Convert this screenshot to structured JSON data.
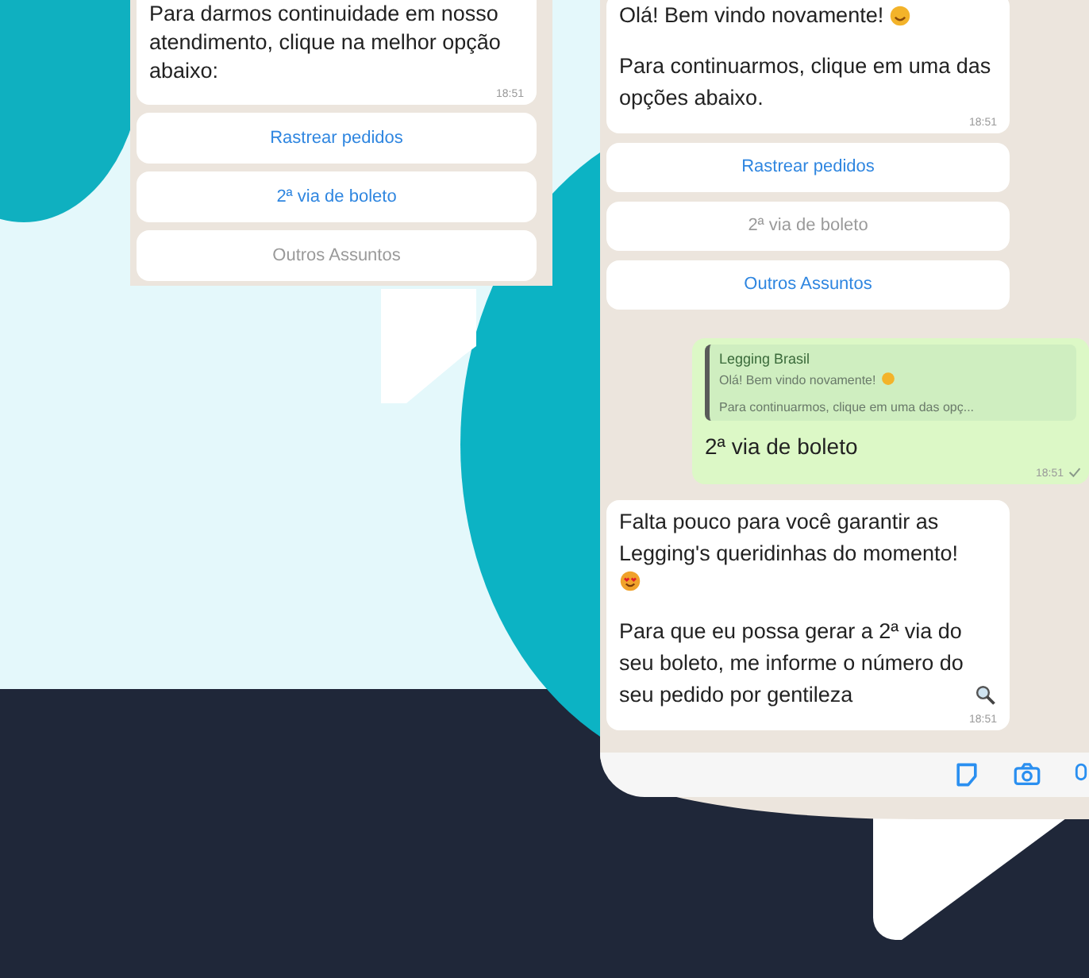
{
  "chats": [
    {
      "messages": [
        {
          "kind": "incoming",
          "paragraphs": [
            {
              "text": "Para darmos continuidade em nosso atendimento, clique na melhor opção abaixo:"
            }
          ],
          "time": "18:51"
        }
      ],
      "options": [
        {
          "label": "Rastrear pedidos",
          "disabled": false
        },
        {
          "label": "2ª via de boleto",
          "disabled": false
        },
        {
          "label": "Outros Assuntos",
          "disabled": true
        }
      ]
    },
    {
      "messages": [
        {
          "kind": "incoming",
          "paragraphs": [
            {
              "text": "Olá! Bem vindo novamente!",
              "icon": {
                "kind": "smile"
              }
            },
            {
              "text": "Para continuarmos, clique em uma das  opções abaixo."
            }
          ],
          "time": "18:51"
        }
      ],
      "options": [
        {
          "label": "Rastrear pedidos",
          "disabled": false
        },
        {
          "label": "2ª via de boleto",
          "disabled": true
        },
        {
          "label": "Outros Assuntos",
          "disabled": false
        }
      ],
      "after": [
        {
          "kind": "outgoing",
          "quote": {
            "author": "Legging Brasil",
            "lines": [
              {
                "text": "Olá! Bem vindo novamente!",
                "icon": {
                  "kind": "smile"
                }
              },
              {
                "text": "Para continuarmos, clique em uma das  opç..."
              }
            ]
          },
          "paragraphs": [
            {
              "text": "2ª via de boleto"
            }
          ],
          "time": "18:51",
          "delivered": true
        },
        {
          "kind": "incoming",
          "paragraphs": [
            {
              "text": "Falta pouco para você garantir as Legging's queridinhas do momento!",
              "icon": {
                "kind": "heart-eyes"
              }
            },
            {
              "text": "Para que eu possa gerar a 2ª via do seu boleto, me informe o número do seu pedido por gentileza",
              "icon": {
                "kind": "search"
              }
            }
          ],
          "time": "18:51"
        }
      ],
      "input_bar": true
    }
  ]
}
